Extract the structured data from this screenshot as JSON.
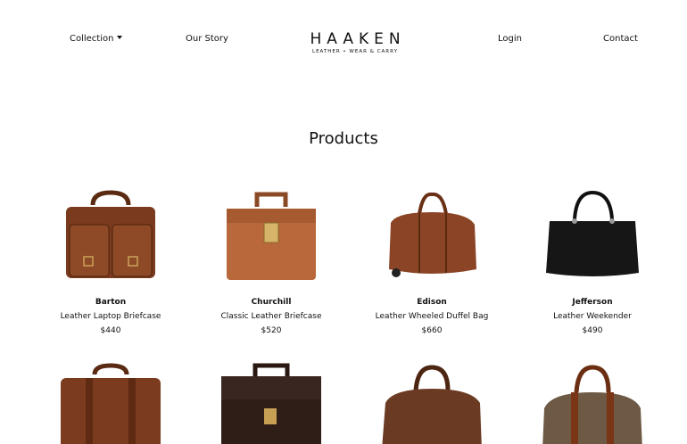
{
  "nav": {
    "collection_label": "Collection",
    "story_label": "Our Story",
    "login_label": "Login",
    "contact_label": "Contact"
  },
  "brand": {
    "name": "HAAKEN",
    "tagline": "LEATHER • WEAR & CARRY"
  },
  "page": {
    "heading": "Products"
  },
  "products": [
    {
      "name": "Barton",
      "desc": "Leather Laptop Briefcase",
      "price": "$440",
      "color": "#7a3a1d"
    },
    {
      "name": "Churchill",
      "desc": "Classic Leather Briefcase",
      "price": "$520",
      "color": "#b8683a"
    },
    {
      "name": "Edison",
      "desc": "Leather Wheeled Duffel Bag",
      "price": "$660",
      "color": "#8b4526"
    },
    {
      "name": "Jefferson",
      "desc": "Leather Weekender",
      "price": "$490",
      "color": "#161616"
    }
  ],
  "products_row2": [
    {
      "color": "#7b3b1e"
    },
    {
      "color": "#2f1d17"
    },
    {
      "color": "#6b3a22"
    },
    {
      "color": "#6e5a44"
    }
  ]
}
